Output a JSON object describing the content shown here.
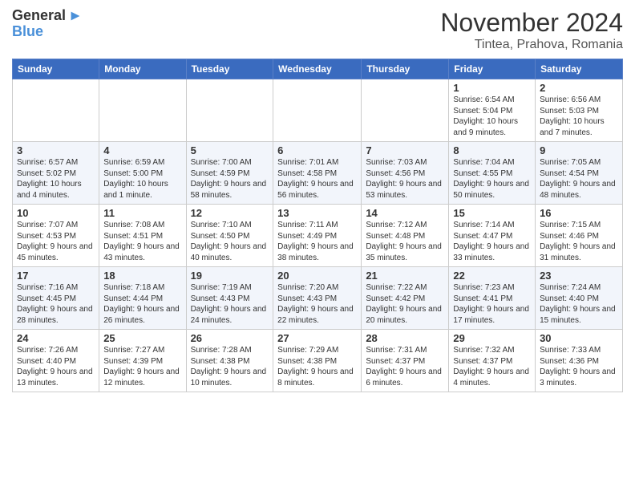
{
  "header": {
    "logo_general": "General",
    "logo_blue": "Blue",
    "month": "November 2024",
    "location": "Tintea, Prahova, Romania"
  },
  "weekdays": [
    "Sunday",
    "Monday",
    "Tuesday",
    "Wednesday",
    "Thursday",
    "Friday",
    "Saturday"
  ],
  "weeks": [
    [
      {
        "day": "",
        "info": ""
      },
      {
        "day": "",
        "info": ""
      },
      {
        "day": "",
        "info": ""
      },
      {
        "day": "",
        "info": ""
      },
      {
        "day": "",
        "info": ""
      },
      {
        "day": "1",
        "info": "Sunrise: 6:54 AM\nSunset: 5:04 PM\nDaylight: 10 hours and 9 minutes."
      },
      {
        "day": "2",
        "info": "Sunrise: 6:56 AM\nSunset: 5:03 PM\nDaylight: 10 hours and 7 minutes."
      }
    ],
    [
      {
        "day": "3",
        "info": "Sunrise: 6:57 AM\nSunset: 5:02 PM\nDaylight: 10 hours and 4 minutes."
      },
      {
        "day": "4",
        "info": "Sunrise: 6:59 AM\nSunset: 5:00 PM\nDaylight: 10 hours and 1 minute."
      },
      {
        "day": "5",
        "info": "Sunrise: 7:00 AM\nSunset: 4:59 PM\nDaylight: 9 hours and 58 minutes."
      },
      {
        "day": "6",
        "info": "Sunrise: 7:01 AM\nSunset: 4:58 PM\nDaylight: 9 hours and 56 minutes."
      },
      {
        "day": "7",
        "info": "Sunrise: 7:03 AM\nSunset: 4:56 PM\nDaylight: 9 hours and 53 minutes."
      },
      {
        "day": "8",
        "info": "Sunrise: 7:04 AM\nSunset: 4:55 PM\nDaylight: 9 hours and 50 minutes."
      },
      {
        "day": "9",
        "info": "Sunrise: 7:05 AM\nSunset: 4:54 PM\nDaylight: 9 hours and 48 minutes."
      }
    ],
    [
      {
        "day": "10",
        "info": "Sunrise: 7:07 AM\nSunset: 4:53 PM\nDaylight: 9 hours and 45 minutes."
      },
      {
        "day": "11",
        "info": "Sunrise: 7:08 AM\nSunset: 4:51 PM\nDaylight: 9 hours and 43 minutes."
      },
      {
        "day": "12",
        "info": "Sunrise: 7:10 AM\nSunset: 4:50 PM\nDaylight: 9 hours and 40 minutes."
      },
      {
        "day": "13",
        "info": "Sunrise: 7:11 AM\nSunset: 4:49 PM\nDaylight: 9 hours and 38 minutes."
      },
      {
        "day": "14",
        "info": "Sunrise: 7:12 AM\nSunset: 4:48 PM\nDaylight: 9 hours and 35 minutes."
      },
      {
        "day": "15",
        "info": "Sunrise: 7:14 AM\nSunset: 4:47 PM\nDaylight: 9 hours and 33 minutes."
      },
      {
        "day": "16",
        "info": "Sunrise: 7:15 AM\nSunset: 4:46 PM\nDaylight: 9 hours and 31 minutes."
      }
    ],
    [
      {
        "day": "17",
        "info": "Sunrise: 7:16 AM\nSunset: 4:45 PM\nDaylight: 9 hours and 28 minutes."
      },
      {
        "day": "18",
        "info": "Sunrise: 7:18 AM\nSunset: 4:44 PM\nDaylight: 9 hours and 26 minutes."
      },
      {
        "day": "19",
        "info": "Sunrise: 7:19 AM\nSunset: 4:43 PM\nDaylight: 9 hours and 24 minutes."
      },
      {
        "day": "20",
        "info": "Sunrise: 7:20 AM\nSunset: 4:43 PM\nDaylight: 9 hours and 22 minutes."
      },
      {
        "day": "21",
        "info": "Sunrise: 7:22 AM\nSunset: 4:42 PM\nDaylight: 9 hours and 20 minutes."
      },
      {
        "day": "22",
        "info": "Sunrise: 7:23 AM\nSunset: 4:41 PM\nDaylight: 9 hours and 17 minutes."
      },
      {
        "day": "23",
        "info": "Sunrise: 7:24 AM\nSunset: 4:40 PM\nDaylight: 9 hours and 15 minutes."
      }
    ],
    [
      {
        "day": "24",
        "info": "Sunrise: 7:26 AM\nSunset: 4:40 PM\nDaylight: 9 hours and 13 minutes."
      },
      {
        "day": "25",
        "info": "Sunrise: 7:27 AM\nSunset: 4:39 PM\nDaylight: 9 hours and 12 minutes."
      },
      {
        "day": "26",
        "info": "Sunrise: 7:28 AM\nSunset: 4:38 PM\nDaylight: 9 hours and 10 minutes."
      },
      {
        "day": "27",
        "info": "Sunrise: 7:29 AM\nSunset: 4:38 PM\nDaylight: 9 hours and 8 minutes."
      },
      {
        "day": "28",
        "info": "Sunrise: 7:31 AM\nSunset: 4:37 PM\nDaylight: 9 hours and 6 minutes."
      },
      {
        "day": "29",
        "info": "Sunrise: 7:32 AM\nSunset: 4:37 PM\nDaylight: 9 hours and 4 minutes."
      },
      {
        "day": "30",
        "info": "Sunrise: 7:33 AM\nSunset: 4:36 PM\nDaylight: 9 hours and 3 minutes."
      }
    ]
  ]
}
